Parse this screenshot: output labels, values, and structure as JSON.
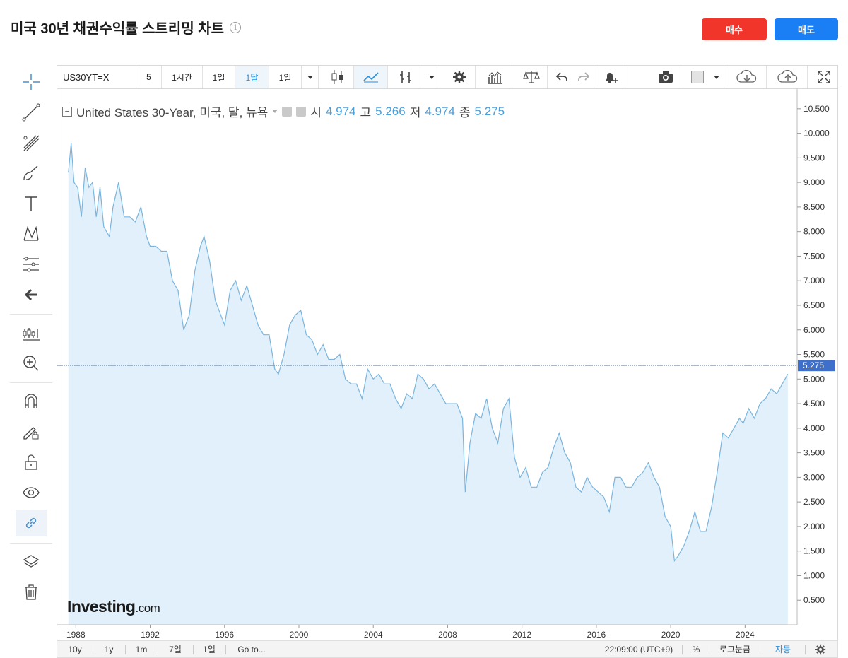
{
  "header": {
    "title": "미국 30년 채권수익률 스트리밍 차트",
    "info_icon": "info-icon",
    "buy_label": "매수",
    "sell_label": "매도",
    "buy_color": "#f2352b",
    "sell_color": "#1a7ef5"
  },
  "toolbar": {
    "symbol": "US30YT=X",
    "interval_5": "5",
    "interval_1h": "1시간",
    "interval_1d": "1일",
    "interval_1mo": "1달",
    "interval_dropdown": "1일",
    "icons": [
      "candlestick-icon",
      "line-chart-icon",
      "bar-type-icon",
      "settings-icon",
      "indicators-icon",
      "compare-icon",
      "undo-icon",
      "redo-icon",
      "alert-icon",
      "camera-icon",
      "color-icon",
      "cloud-download-icon",
      "cloud-upload-icon",
      "fullscreen-icon"
    ]
  },
  "legend": {
    "name": "United States 30-Year, 미국, 달, 뉴욕",
    "open_label": "시",
    "open": "4.974",
    "high_label": "고",
    "high": "5.266",
    "low_label": "저",
    "low": "4.974",
    "close_label": "종",
    "close": "5.275"
  },
  "left_tools": [
    "crosshair-icon",
    "trend-line-icon",
    "fib-icon",
    "brush-icon",
    "text-icon",
    "pattern-icon",
    "measure-icon",
    "back-arrow-icon",
    "zoom-chart-icon",
    "zoom-in-icon",
    "magnet-icon",
    "lock-drawing-icon",
    "unlock-icon",
    "eye-icon",
    "link-icon",
    "layers-icon",
    "trash-icon"
  ],
  "bottom_bar": {
    "ranges": [
      "10y",
      "1y",
      "1m",
      "7일",
      "1일"
    ],
    "goto": "Go to...",
    "time": "22:09:00 (UTC+9)",
    "percent": "%",
    "log": "로그눈금",
    "auto": "자동",
    "settings_icon": "settings-icon"
  },
  "logo": {
    "text": "Investing",
    "suffix": ".com"
  },
  "chart_data": {
    "type": "area",
    "title": "United States 30-Year, 미국, 달, 뉴욕",
    "y_ticks": [
      "10.500",
      "10.000",
      "9.500",
      "9.000",
      "8.500",
      "8.000",
      "7.500",
      "7.000",
      "6.500",
      "6.000",
      "5.500",
      "5.000",
      "4.500",
      "4.000",
      "3.500",
      "3.000",
      "2.500",
      "2.000",
      "1.500",
      "1.000",
      "0.500"
    ],
    "x_ticks": [
      "1988",
      "1992",
      "1996",
      "2000",
      "2004",
      "2008",
      "2012",
      "2016",
      "2020",
      "2024"
    ],
    "ylim": [
      0.0,
      10.9
    ],
    "xlim": [
      1987.0,
      2026.8
    ],
    "last_value": "5.275",
    "line_color": "#7ab5de",
    "fill_color": "#e1f0fa",
    "x": [
      1987.6,
      1987.75,
      1987.9,
      1988.1,
      1988.3,
      1988.5,
      1988.7,
      1988.9,
      1989.1,
      1989.3,
      1989.5,
      1989.8,
      1990.0,
      1990.3,
      1990.6,
      1990.9,
      1991.2,
      1991.5,
      1991.8,
      1992.0,
      1992.3,
      1992.6,
      1992.9,
      1993.2,
      1993.5,
      1993.8,
      1994.1,
      1994.4,
      1994.7,
      1994.9,
      1995.2,
      1995.5,
      1995.8,
      1996.0,
      1996.3,
      1996.6,
      1996.9,
      1997.2,
      1997.5,
      1997.8,
      1998.1,
      1998.4,
      1998.7,
      1998.9,
      1999.2,
      1999.5,
      1999.8,
      2000.1,
      2000.4,
      2000.7,
      2001.0,
      2001.3,
      2001.6,
      2001.9,
      2002.2,
      2002.5,
      2002.8,
      2003.1,
      2003.4,
      2003.7,
      2004.0,
      2004.3,
      2004.6,
      2004.9,
      2005.2,
      2005.5,
      2005.8,
      2006.1,
      2006.4,
      2006.7,
      2007.0,
      2007.3,
      2007.6,
      2007.9,
      2008.2,
      2008.5,
      2008.8,
      2008.95,
      2009.2,
      2009.5,
      2009.8,
      2010.1,
      2010.4,
      2010.7,
      2011.0,
      2011.3,
      2011.6,
      2011.9,
      2012.2,
      2012.5,
      2012.8,
      2013.1,
      2013.4,
      2013.7,
      2014.0,
      2014.3,
      2014.6,
      2014.9,
      2015.2,
      2015.5,
      2015.8,
      2016.1,
      2016.4,
      2016.7,
      2017.0,
      2017.3,
      2017.6,
      2017.9,
      2018.2,
      2018.5,
      2018.8,
      2019.1,
      2019.4,
      2019.7,
      2020.0,
      2020.2,
      2020.4,
      2020.7,
      2021.0,
      2021.3,
      2021.6,
      2021.9,
      2022.2,
      2022.5,
      2022.8,
      2023.1,
      2023.4,
      2023.7,
      2023.9,
      2024.2,
      2024.5,
      2024.8,
      2025.1,
      2025.4,
      2025.7,
      2026.0,
      2026.3
    ],
    "y": [
      9.2,
      9.8,
      9.0,
      8.9,
      8.3,
      9.3,
      8.9,
      9.0,
      8.3,
      8.9,
      8.1,
      7.9,
      8.5,
      9.0,
      8.3,
      8.3,
      8.2,
      8.5,
      7.9,
      7.7,
      7.7,
      7.6,
      7.6,
      7.0,
      6.8,
      6.0,
      6.3,
      7.2,
      7.7,
      7.9,
      7.4,
      6.6,
      6.3,
      6.1,
      6.8,
      7.0,
      6.6,
      6.9,
      6.5,
      6.1,
      5.9,
      5.9,
      5.2,
      5.1,
      5.5,
      6.1,
      6.3,
      6.4,
      5.9,
      5.8,
      5.5,
      5.7,
      5.4,
      5.4,
      5.5,
      5.0,
      4.9,
      4.9,
      4.6,
      5.2,
      5.0,
      5.1,
      4.9,
      4.9,
      4.6,
      4.4,
      4.7,
      4.6,
      5.1,
      5.0,
      4.8,
      4.9,
      4.7,
      4.5,
      4.5,
      4.5,
      4.2,
      2.7,
      3.7,
      4.3,
      4.2,
      4.6,
      4.0,
      3.7,
      4.4,
      4.6,
      3.4,
      3.0,
      3.2,
      2.8,
      2.8,
      3.1,
      3.2,
      3.6,
      3.9,
      3.5,
      3.3,
      2.8,
      2.7,
      3.0,
      2.8,
      2.7,
      2.6,
      2.3,
      3.0,
      3.0,
      2.8,
      2.8,
      3.0,
      3.1,
      3.3,
      3.0,
      2.8,
      2.2,
      2.0,
      1.3,
      1.4,
      1.6,
      1.9,
      2.3,
      1.9,
      1.9,
      2.4,
      3.1,
      3.9,
      3.8,
      4.0,
      4.2,
      4.1,
      4.4,
      4.2,
      4.5,
      4.6,
      4.8,
      4.7,
      4.9,
      5.1
    ]
  }
}
